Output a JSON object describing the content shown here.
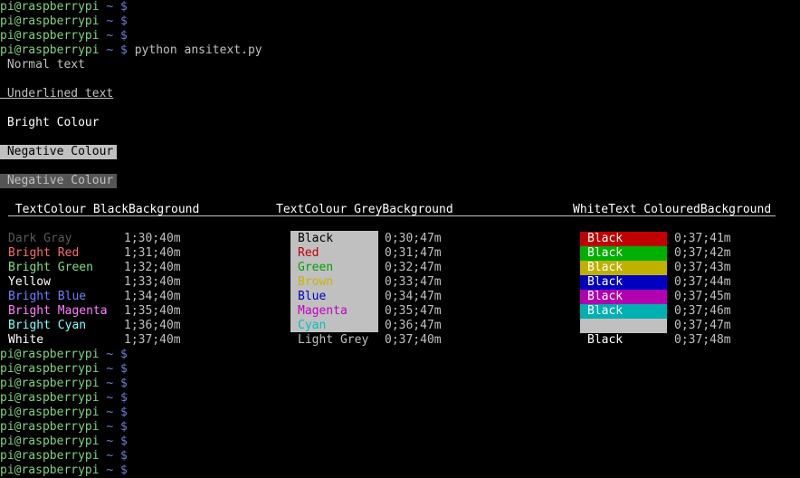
{
  "prompt": {
    "user": "pi@raspberrypi",
    "sep": " ~ $"
  },
  "command": "python ansitext.py",
  "intro": {
    "normal": " Normal text",
    "underlined": " Underlined text",
    "bright": " Bright Colour",
    "negative1": " Negative Colour",
    "negative2": " Negative Colour"
  },
  "headers": {
    "col1": " TextColour BlackBackground",
    "col2": "TextColour GreyBackground",
    "col3": "WhiteText ColouredBackground"
  },
  "col1": [
    {
      "label": "Dark Gray",
      "code": "1;30;40m",
      "color": "#5a5a5a"
    },
    {
      "label": "Bright Red",
      "code": "1;31;40m",
      "color": "#ff6b6b"
    },
    {
      "label": "Bright Green",
      "code": "1;32;40m",
      "color": "#7fe07f"
    },
    {
      "label": "Yellow",
      "code": "1;33;40m",
      "color": "#ffffff"
    },
    {
      "label": "Bright Blue",
      "code": "1;34;40m",
      "color": "#6f7fff"
    },
    {
      "label": "Bright Magenta",
      "code": "1;35;40m",
      "color": "#ff7fff"
    },
    {
      "label": "Bright Cyan",
      "code": "1;36;40m",
      "color": "#7fffff"
    },
    {
      "label": "White",
      "code": "1;37;40m",
      "color": "#ffffff"
    }
  ],
  "col2": [
    {
      "label": "Black",
      "code": "0;30;47m",
      "color": "#000000"
    },
    {
      "label": "Red",
      "code": "0;31;47m",
      "color": "#c00000"
    },
    {
      "label": "Green",
      "code": "0;32;47m",
      "color": "#00a000"
    },
    {
      "label": "Brown",
      "code": "0;33;47m",
      "color": "#c8b400"
    },
    {
      "label": "Blue",
      "code": "0;34;47m",
      "color": "#0000c0"
    },
    {
      "label": "Magenta",
      "code": "0;35;47m",
      "color": "#c000c0"
    },
    {
      "label": "Cyan",
      "code": "0;36;47m",
      "color": "#00c0c0"
    },
    {
      "label": "Light Grey",
      "code": "0;37;40m",
      "color": "#c0c0c0"
    }
  ],
  "col3": [
    {
      "label": "Black",
      "code": "0;37;41m",
      "bg": "#c00000"
    },
    {
      "label": "Black",
      "code": "0;37;42m",
      "bg": "#00b000"
    },
    {
      "label": "Black",
      "code": "0;37;43m",
      "bg": "#c0b000"
    },
    {
      "label": "Black",
      "code": "0;37;44m",
      "bg": "#0000c0"
    },
    {
      "label": "Black",
      "code": "0;37;45m",
      "bg": "#b000b0"
    },
    {
      "label": "Black",
      "code": "0;37;46m",
      "bg": "#00b0b0"
    },
    {
      "label": "",
      "code": "0;37;47m",
      "bg": "#c0c0c0"
    },
    {
      "label": "Black",
      "code": "0;37;48m",
      "bg": "#000000"
    }
  ],
  "colors": {
    "grey_bg": "#c0c0c0",
    "dark_grey_bg": "#555555",
    "prompt_user": "#7fd37f",
    "prompt_sep": "#6f7fd8"
  }
}
